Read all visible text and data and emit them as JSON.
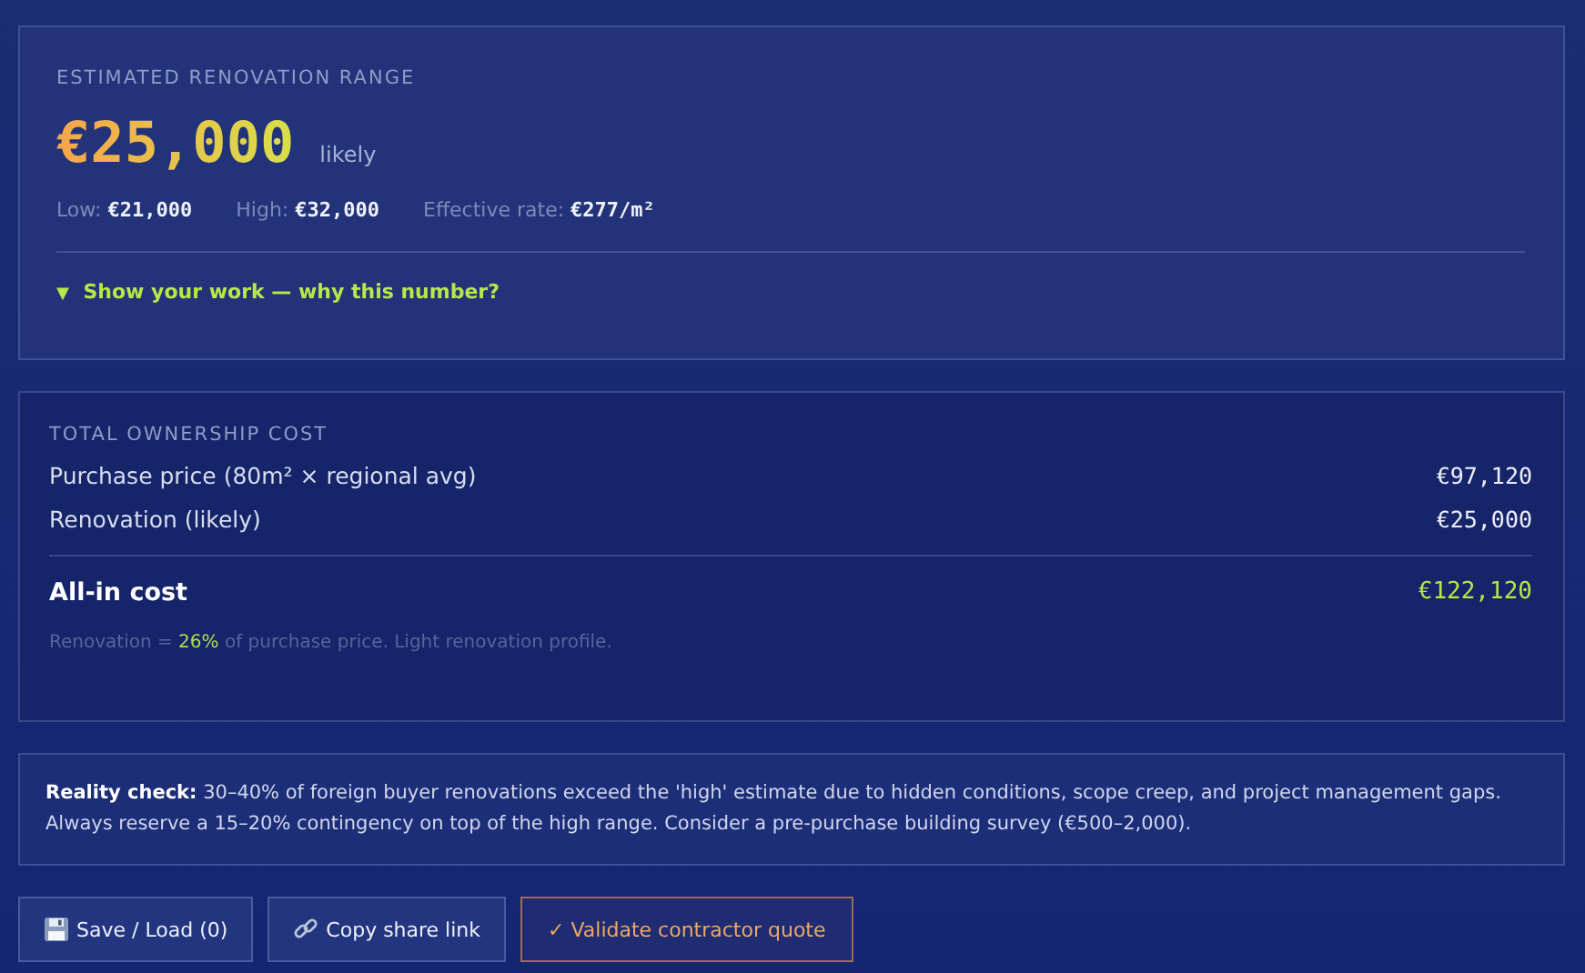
{
  "estimate": {
    "heading": "ESTIMATED RENOVATION RANGE",
    "amount": "€25,000",
    "qualifier": "likely",
    "stats": [
      {
        "label": "Low:",
        "value": "€21,000"
      },
      {
        "label": "High:",
        "value": "€32,000"
      },
      {
        "label": "Effective rate:",
        "value": "€277/m²"
      }
    ],
    "disclosure": {
      "marker": "▼",
      "label": "Show your work — why this number?"
    }
  },
  "ownership": {
    "heading": "TOTAL OWNERSHIP COST",
    "rows": [
      {
        "label": "Purchase price (80m² × regional avg)",
        "value": "€97,120"
      },
      {
        "label": "Renovation (likely)",
        "value": "€25,000"
      }
    ],
    "total": {
      "label": "All-in cost",
      "value": "€122,120"
    },
    "note": {
      "before": "Renovation = ",
      "highlight": "26%",
      "after": " of purchase price. Light renovation profile."
    }
  },
  "reality_check": "**Reality check:** 30–40% of foreign buyer renovations exceed the 'high' estimate due to hidden conditions, scope creep, and project management gaps. Always reserve a 15–20% contingency on top of the high range. Consider a pre-purchase building survey (€500–2,000).",
  "buttons": [
    {
      "kind": "save",
      "label": "Save / Load (0)"
    },
    {
      "kind": "share",
      "label": "Copy share link"
    },
    {
      "kind": "validate",
      "label": "✓ Validate contractor quote"
    }
  ]
}
